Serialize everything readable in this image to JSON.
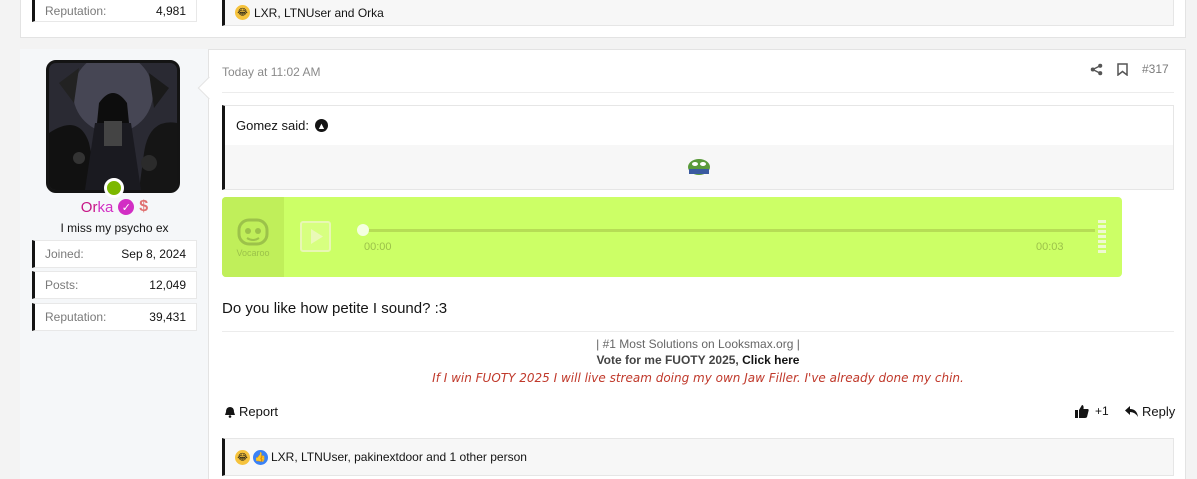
{
  "previous_post": {
    "reputation_label": "Reputation:",
    "reputation_value": "4,981",
    "reactions_text": "LXR, LTNUser and Orka"
  },
  "user": {
    "name_part1": "Or",
    "name_part2": "ka",
    "title": "I miss my psycho ex",
    "online": true,
    "stats": [
      {
        "label": "Joined:",
        "value": "Sep 8, 2024"
      },
      {
        "label": "Posts:",
        "value": "12,049"
      },
      {
        "label": "Reputation:",
        "value": "39,431"
      }
    ]
  },
  "post": {
    "date": "Today at 11:02 AM",
    "number": "#317",
    "quote_author": "Gomez said:",
    "audio": {
      "brand": "Vocaroo",
      "current_time": "00:00",
      "duration": "00:03",
      "progress": 0
    },
    "message": "Do you like how petite I sound? :3",
    "signature": {
      "line1": "| #1 Most Solutions on Looksmax.org |",
      "line2_prefix": "Vote for me FUOTY 2025, ",
      "line2_link": "Click here",
      "line3": "If I win FUOTY 2025 I will live stream doing my own Jaw Filler. I've already done my chin."
    },
    "report_label": "Report",
    "react_label": "+1",
    "reply_label": "Reply",
    "reactions_text": "LXR, LTNUser, pakinextdoor and 1 other person"
  },
  "colors": {
    "vocaroo_bg": "#ccff66",
    "online_dot": "#7cb800",
    "signature_red": "#c0392b",
    "username_pink": "#d22ec4"
  }
}
